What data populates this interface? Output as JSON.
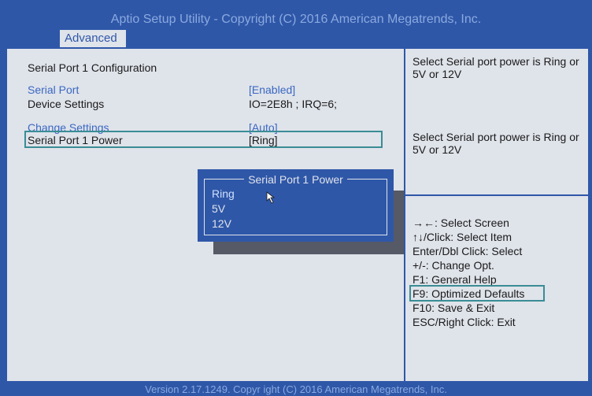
{
  "header": {
    "title": "Aptio Setup Utility - Copyright (C) 2016 American Megatrends, Inc.",
    "tab": "Advanced"
  },
  "main": {
    "section_title": "Serial Port 1 Configuration",
    "rows": [
      {
        "label": "Serial Port",
        "value": "[Enabled]"
      },
      {
        "label": "Device Settings",
        "value": "IO=2E8h ; IRQ=6;"
      },
      {
        "label": "Change Settings",
        "value": "[Auto]"
      },
      {
        "label": "Serial Port 1 Power",
        "value": "[Ring]"
      }
    ]
  },
  "popup": {
    "title": "Serial Port 1 Power",
    "options": [
      "Ring",
      "5V",
      "12V"
    ],
    "selected": "Ring"
  },
  "help": {
    "description_1": "Select Serial port power is Ring or 5V or 12V",
    "description_2": "Select Serial port power is Ring or 5V or 12V",
    "keys": [
      "→←: Select Screen",
      "↑↓/Click: Select Item",
      "Enter/Dbl Click: Select",
      "+/-: Change Opt.",
      "F1: General Help",
      "F9: Optimized Defaults",
      "F10: Save & Exit",
      "ESC/Right Click: Exit"
    ]
  },
  "footer": {
    "version": "Version 2.17.1249. Copyr ight (C) 2016 American Megatrends, Inc."
  },
  "colors": {
    "background": "#2f57a8",
    "panel": "#dfe3ea",
    "highlight": "#3a8d95",
    "link": "#3a68c2"
  }
}
